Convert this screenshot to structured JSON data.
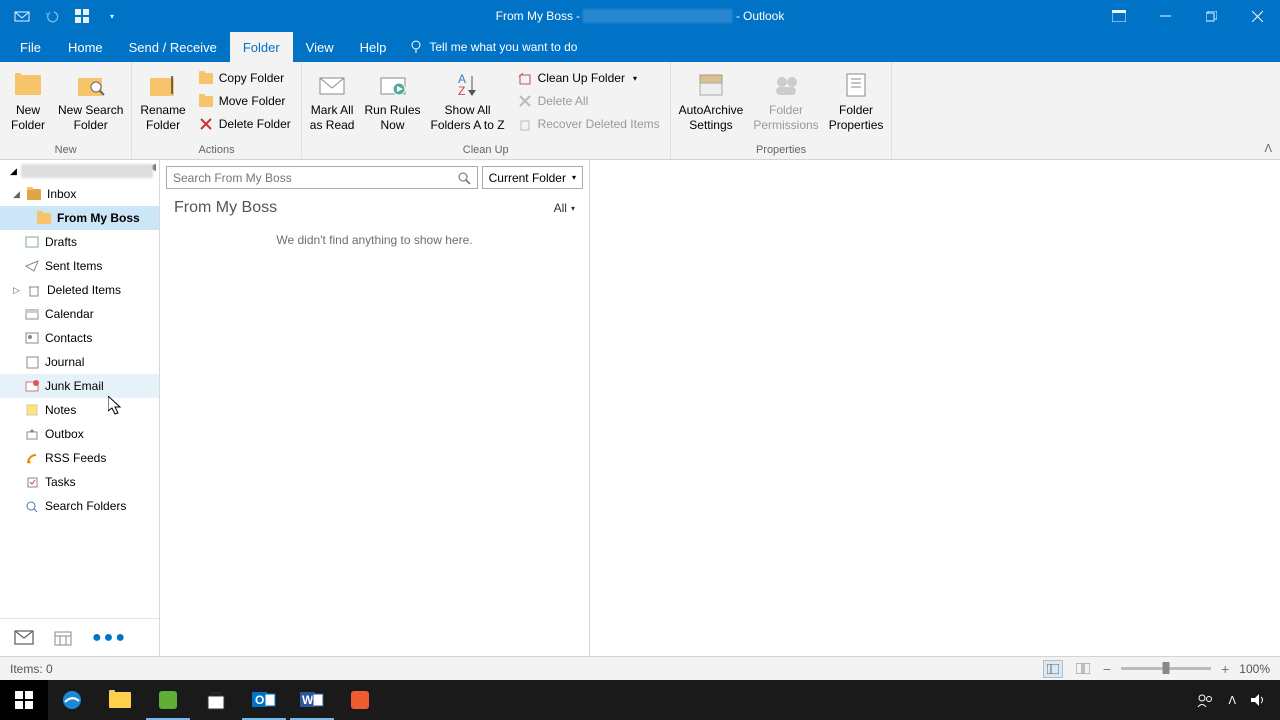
{
  "title": {
    "folder": "From My Boss",
    "sep": "-",
    "app": "Outlook"
  },
  "tabs": {
    "file": "File",
    "home": "Home",
    "sendreceive": "Send / Receive",
    "folder": "Folder",
    "view": "View",
    "help": "Help",
    "tellme": "Tell me what you want to do"
  },
  "ribbon": {
    "new_group": "New",
    "new_folder": "New\nFolder",
    "new_search_folder": "New Search\nFolder",
    "actions_group": "Actions",
    "rename_folder": "Rename\nFolder",
    "copy_folder": "Copy Folder",
    "move_folder": "Move Folder",
    "delete_folder": "Delete Folder",
    "cleanup_group": "Clean Up",
    "mark_all_read": "Mark All\nas Read",
    "run_rules": "Run Rules\nNow",
    "show_all_az": "Show All\nFolders A to Z",
    "clean_up_folder": "Clean Up Folder",
    "delete_all": "Delete All",
    "recover_deleted": "Recover Deleted Items",
    "properties_group": "Properties",
    "autoarchive": "AutoArchive\nSettings",
    "folder_permissions": "Folder\nPermissions",
    "folder_props": "Folder\nProperties"
  },
  "nav": {
    "inbox": "Inbox",
    "from_boss": "From My Boss",
    "drafts": "Drafts",
    "sent": "Sent Items",
    "deleted": "Deleted Items",
    "calendar": "Calendar",
    "contacts": "Contacts",
    "journal": "Journal",
    "junk": "Junk Email",
    "notes": "Notes",
    "outbox": "Outbox",
    "rss": "RSS Feeds",
    "tasks": "Tasks",
    "search_folders": "Search Folders"
  },
  "list": {
    "search_placeholder": "Search From My Boss",
    "scope": "Current Folder",
    "header": "From My Boss",
    "filter": "All",
    "empty": "We didn't find anything to show here."
  },
  "status": {
    "items": "Items: 0",
    "zoom": "100%"
  }
}
